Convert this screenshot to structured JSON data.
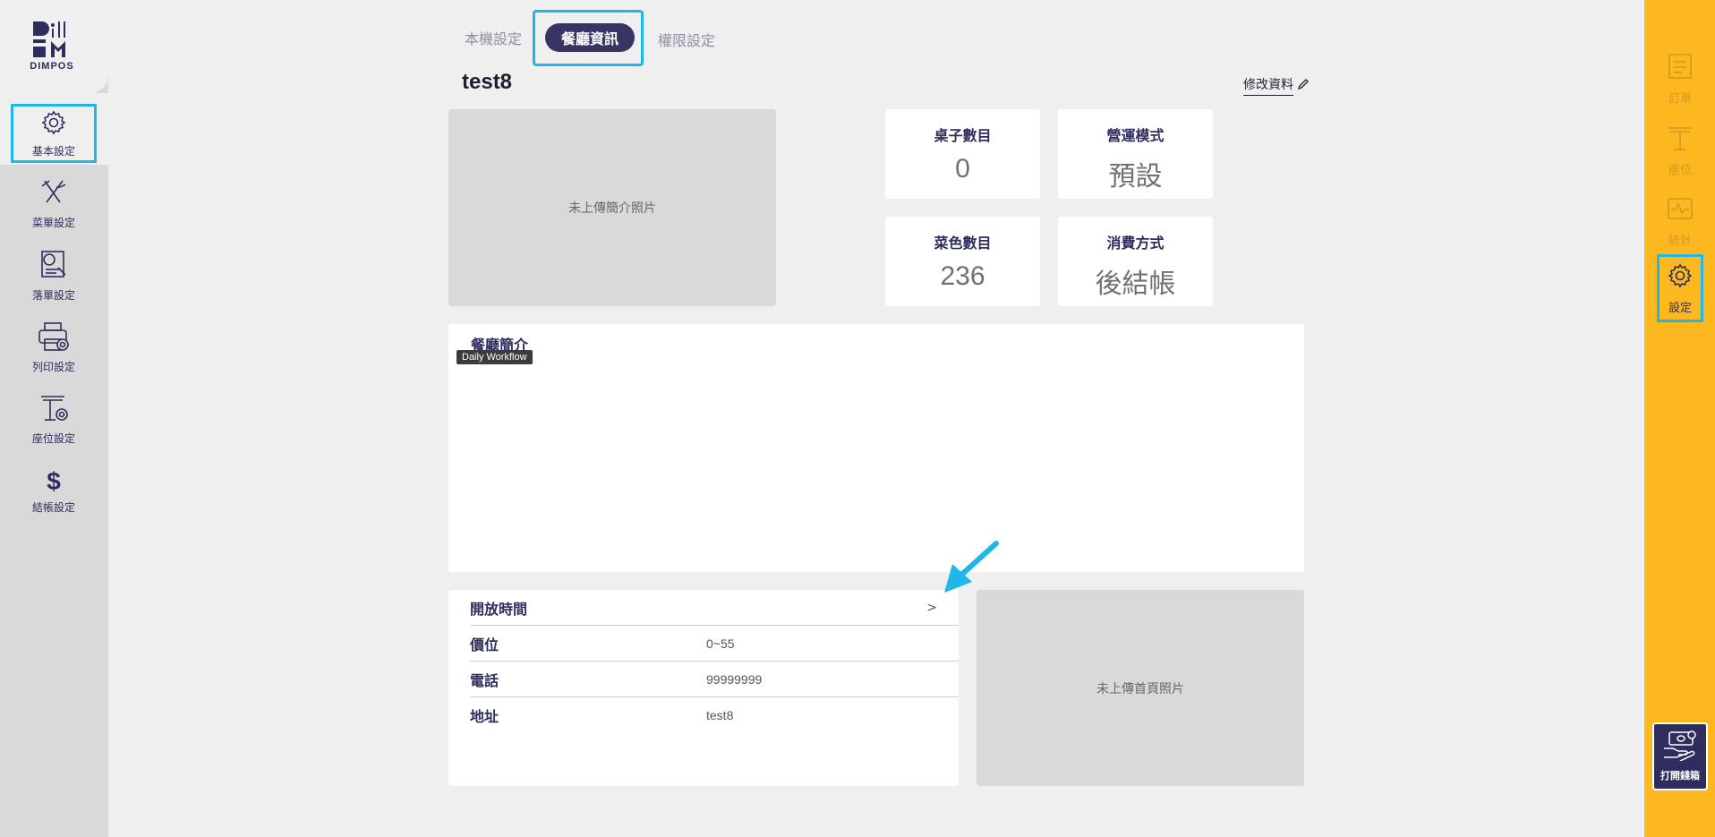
{
  "logo": {
    "text": "DIMPOS"
  },
  "sidebar": {
    "items": [
      {
        "label": "基本設定",
        "icon": "gear-icon"
      },
      {
        "label": "菜單設定",
        "icon": "fork-knife-icon"
      },
      {
        "label": "落單設定",
        "icon": "order-settings-icon"
      },
      {
        "label": "列印設定",
        "icon": "printer-settings-icon"
      },
      {
        "label": "座位設定",
        "icon": "seat-settings-icon"
      },
      {
        "label": "結帳設定",
        "icon": "dollar-icon"
      }
    ]
  },
  "tabs": [
    {
      "label": "本機設定"
    },
    {
      "label": "餐廳資訊"
    },
    {
      "label": "權限設定"
    }
  ],
  "restaurant": {
    "name": "test8",
    "edit_label": "修改資料",
    "intro_photo_placeholder": "未上傳簡介照片",
    "home_photo_placeholder": "未上傳首頁照片"
  },
  "stats": [
    {
      "label": "桌子數目",
      "value": "0"
    },
    {
      "label": "營運模式",
      "value": "預設"
    },
    {
      "label": "菜色數目",
      "value": "236"
    },
    {
      "label": "消費方式",
      "value": "後結帳"
    }
  ],
  "intro": {
    "title": "餐廳簡介",
    "tooltip": "Daily Workflow"
  },
  "info": {
    "rows": [
      {
        "key": "開放時間",
        "value": ""
      },
      {
        "key": "價位",
        "value": "0~55"
      },
      {
        "key": "電話",
        "value": "99999999"
      },
      {
        "key": "地址",
        "value": "test8"
      }
    ]
  },
  "right_sidebar": {
    "items": [
      {
        "label": "訂單",
        "icon": "order-icon"
      },
      {
        "label": "座位",
        "icon": "seat-icon"
      },
      {
        "label": "統計",
        "icon": "stats-icon"
      },
      {
        "label": "設定",
        "icon": "gear-icon"
      }
    ],
    "cash_box_label": "打開錢箱"
  },
  "colors": {
    "accent_highlight": "#1fb6e8",
    "brand_navy": "#2e2d5e",
    "right_bar": "#fdb71f"
  }
}
